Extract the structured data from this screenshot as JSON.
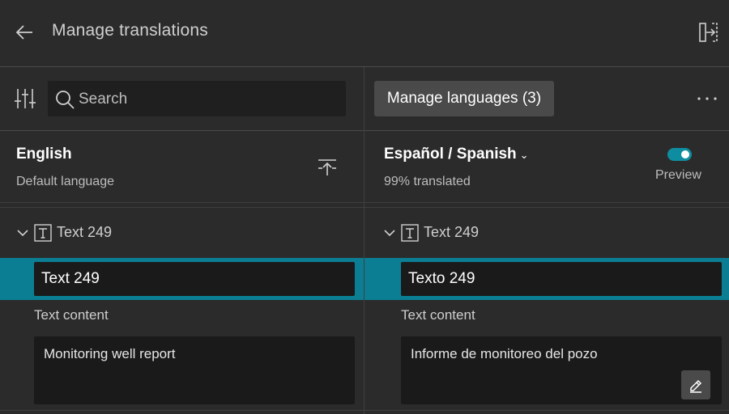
{
  "header": {
    "title": "Manage translations",
    "back_icon": "back-arrow-icon",
    "exit_icon": "exit-panel-icon"
  },
  "left": {
    "search": {
      "placeholder": "Search",
      "value": ""
    },
    "language": {
      "name": "English",
      "subtitle": "Default language"
    },
    "item": {
      "header_label": "Text 249",
      "name_value": "Text 249",
      "content_label": "Text content",
      "content_value": "Monitoring well report"
    }
  },
  "right": {
    "manage_languages_label": "Manage languages (3)",
    "language": {
      "name": "Español / Spanish",
      "subtitle": "99% translated"
    },
    "preview_label": "Preview",
    "preview_enabled": true,
    "item": {
      "header_label": "Text 249",
      "name_value": "Texto 249",
      "content_label": "Text content",
      "content_value": "Informe de monitoreo del pozo"
    }
  },
  "colors": {
    "background": "#2b2b2b",
    "field": "#1a1a1a",
    "accent": "#0b7e93",
    "toggle": "#0f8da0"
  }
}
